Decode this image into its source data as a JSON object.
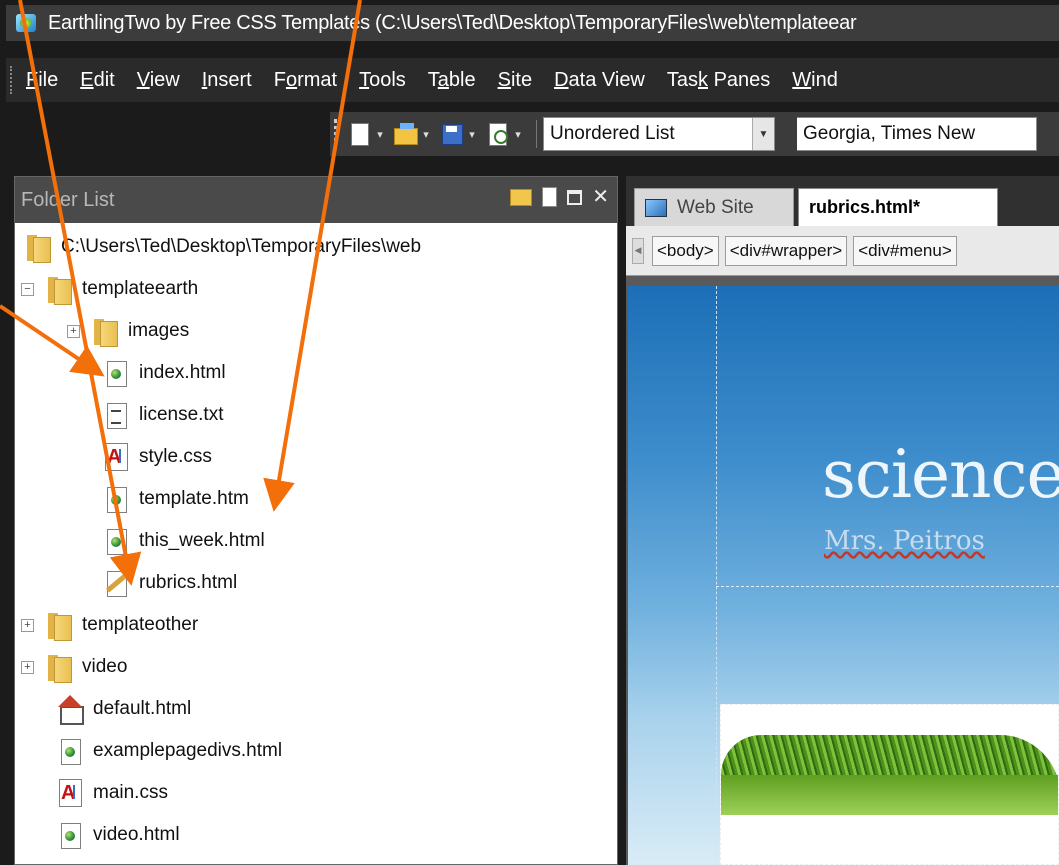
{
  "window": {
    "title": "EarthlingTwo by Free CSS Templates (C:\\Users\\Ted\\Desktop\\TemporaryFiles\\web\\templateear"
  },
  "menu": [
    {
      "label": "File",
      "key": "F",
      "rest": "ile"
    },
    {
      "label": "Edit",
      "key": "E",
      "rest": "dit"
    },
    {
      "label": "View",
      "key": "V",
      "rest": "iew"
    },
    {
      "label": "Insert",
      "key": "I",
      "rest": "nsert"
    },
    {
      "label": "Format",
      "pre": "F",
      "key": "o",
      "rest": "rmat"
    },
    {
      "label": "Tools",
      "key": "T",
      "rest": "ools"
    },
    {
      "label": "Table",
      "pre": "T",
      "key": "a",
      "rest": "ble"
    },
    {
      "label": "Site",
      "key": "S",
      "rest": "ite"
    },
    {
      "label": "Data View",
      "key": "D",
      "rest": "ata View"
    },
    {
      "label": "Task Panes",
      "pre": "Tas",
      "key": "k",
      "rest": " Panes"
    },
    {
      "label": "Wind",
      "key": "W",
      "rest": "ind"
    }
  ],
  "toolbar": {
    "style_value": "Unordered List",
    "font_value": "Georgia, Times New"
  },
  "folder_list": {
    "title": "Folder List",
    "root": "C:\\Users\\Ted\\Desktop\\TemporaryFiles\\web",
    "items": [
      {
        "label": "templateearth",
        "icon": "folder-icon",
        "toggle": "−",
        "depth": 0
      },
      {
        "label": "images",
        "icon": "folder-icon",
        "toggle": "+",
        "depth": 1
      },
      {
        "label": "index.html",
        "icon": "html-page-icon",
        "depth": 1
      },
      {
        "label": "license.txt",
        "icon": "text-file-icon",
        "depth": 1
      },
      {
        "label": "style.css",
        "icon": "css-file-icon",
        "depth": 1
      },
      {
        "label": "template.htm",
        "icon": "html-page-icon",
        "depth": 1
      },
      {
        "label": "this_week.html",
        "icon": "html-page-icon",
        "depth": 1
      },
      {
        "label": "rubrics.html",
        "icon": "edit-page-icon",
        "depth": 1
      },
      {
        "label": "templateother",
        "icon": "folder-icon",
        "toggle": "+",
        "depth": 0
      },
      {
        "label": "video",
        "icon": "folder-icon",
        "toggle": "+",
        "depth": 0
      },
      {
        "label": "default.html",
        "icon": "home-page-icon",
        "depth": 0
      },
      {
        "label": "examplepagedivs.html",
        "icon": "html-page-icon",
        "depth": 0
      },
      {
        "label": "main.css",
        "icon": "css-file-icon",
        "depth": 0
      },
      {
        "label": "video.html",
        "icon": "html-page-icon",
        "depth": 0
      }
    ]
  },
  "editor": {
    "tabs": [
      {
        "label": "Web Site"
      },
      {
        "label": "rubrics.html*"
      }
    ],
    "crumbs": [
      "<body>",
      "<div#wrapper>",
      "<div#menu>"
    ],
    "page_title": "science",
    "page_subtitle": "Mrs. Peitros"
  },
  "colors": {
    "arrow": "#f36f0a",
    "titlebar": "#3c3c3c",
    "panel_header": "#4a4a4a"
  }
}
